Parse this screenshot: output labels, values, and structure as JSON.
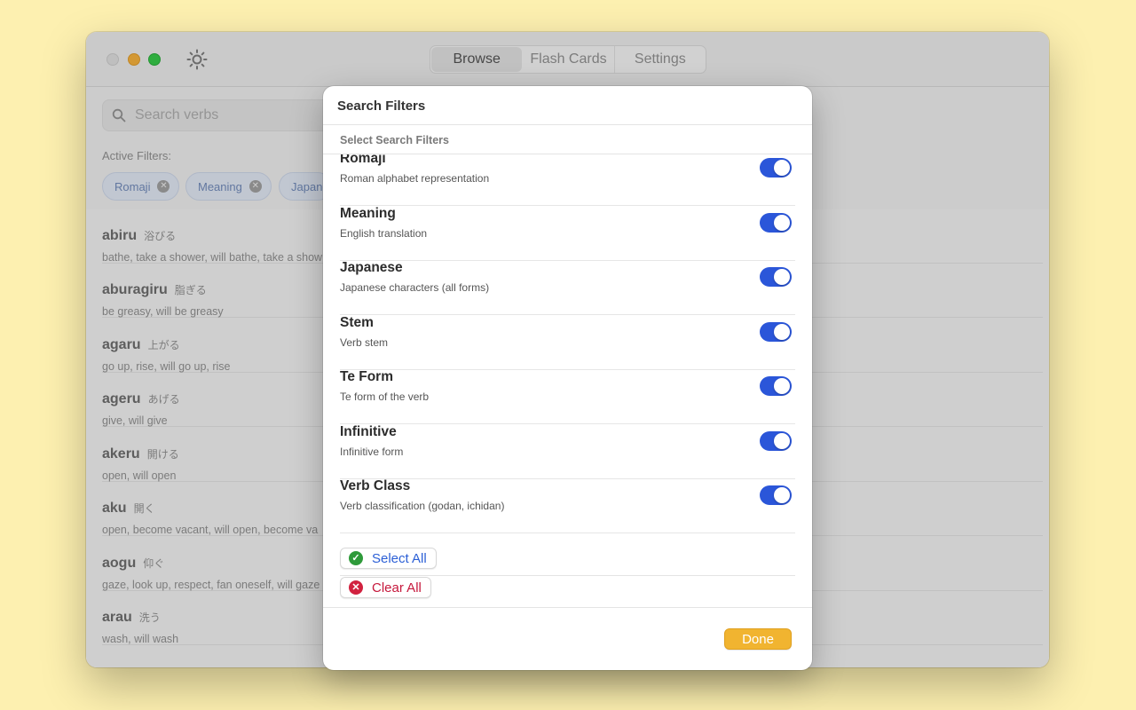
{
  "window": {
    "tabs": [
      {
        "label": "Browse",
        "active": true
      },
      {
        "label": "Flash Cards",
        "active": false
      },
      {
        "label": "Settings",
        "active": false
      }
    ]
  },
  "search": {
    "placeholder": "Search verbs"
  },
  "active_filters": {
    "label": "Active Filters:",
    "chips": [
      "Romaji",
      "Meaning",
      "Japane"
    ]
  },
  "verbs": [
    {
      "romaji": "abiru",
      "kana": "浴びる",
      "meaning": "bathe, take a shower, will bathe, take a show"
    },
    {
      "romaji": "aburagiru",
      "kana": "脂ぎる",
      "meaning": "be greasy, will be greasy"
    },
    {
      "romaji": "agaru",
      "kana": "上がる",
      "meaning": "go up, rise, will go up, rise"
    },
    {
      "romaji": "ageru",
      "kana": "あげる",
      "meaning": "give, will give"
    },
    {
      "romaji": "akeru",
      "kana": "開ける",
      "meaning": "open, will open"
    },
    {
      "romaji": "aku",
      "kana": "開く",
      "meaning": "open, become vacant, will open, become va"
    },
    {
      "romaji": "aogu",
      "kana": "仰ぐ",
      "meaning": "gaze, look up, respect, fan oneself, will gaze"
    },
    {
      "romaji": "arau",
      "kana": "洗う",
      "meaning": "wash, will wash"
    }
  ],
  "sheet": {
    "title": "Search Filters",
    "section_header": "Select Search Filters",
    "filters": [
      {
        "title": "Romaji",
        "description": "Roman alphabet representation",
        "enabled": true
      },
      {
        "title": "Meaning",
        "description": "English translation",
        "enabled": true
      },
      {
        "title": "Japanese",
        "description": "Japanese characters (all forms)",
        "enabled": true
      },
      {
        "title": "Stem",
        "description": "Verb stem",
        "enabled": true
      },
      {
        "title": "Te Form",
        "description": "Te form of the verb",
        "enabled": true
      },
      {
        "title": "Infinitive",
        "description": "Infinitive form",
        "enabled": true
      },
      {
        "title": "Verb Class",
        "description": "Verb classification (godan, ichidan)",
        "enabled": true
      }
    ],
    "select_all_label": "Select All",
    "clear_all_label": "Clear All",
    "done_label": "Done"
  },
  "colors": {
    "accent": "#2b56d9",
    "done_button": "#f1b430",
    "select_all_icon": "#2e9a3a",
    "clear_all": "#c6183c"
  },
  "icons": {
    "appearance": "sun-icon",
    "search": "search-icon",
    "chip_remove": "close-circle-icon",
    "select_all": "checkmark-circle-icon",
    "clear_all": "x-circle-icon"
  }
}
